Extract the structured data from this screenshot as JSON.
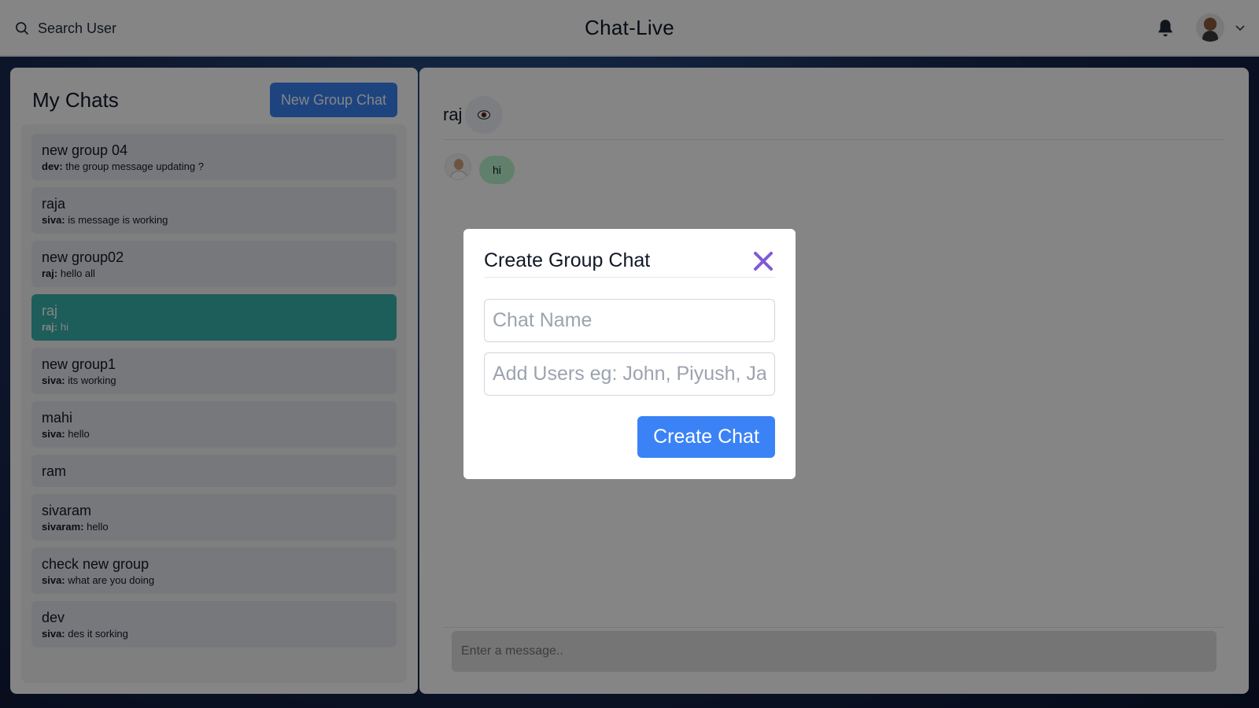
{
  "topbar": {
    "search_label": "Search User",
    "app_title": "Chat-Live"
  },
  "sidebar": {
    "title": "My Chats",
    "new_group_label": "New Group Chat",
    "chats": [
      {
        "name": "new group 04",
        "sender": "dev:",
        "message": " the group message updating ?",
        "active": false
      },
      {
        "name": "raja",
        "sender": "siva:",
        "message": " is message is working",
        "active": false
      },
      {
        "name": "new group02",
        "sender": "raj:",
        "message": " hello all",
        "active": false
      },
      {
        "name": "raj",
        "sender": "raj:",
        "message": " hi",
        "active": true
      },
      {
        "name": "new group1",
        "sender": "siva:",
        "message": " its working",
        "active": false
      },
      {
        "name": "mahi",
        "sender": "siva:",
        "message": " hello",
        "active": false
      },
      {
        "name": "ram",
        "sender": "",
        "message": "",
        "active": false
      },
      {
        "name": "sivaram",
        "sender": "sivaram:",
        "message": " hello",
        "active": false
      },
      {
        "name": "check new group",
        "sender": "siva:",
        "message": " what are you doing",
        "active": false
      },
      {
        "name": "dev",
        "sender": "siva:",
        "message": " des it sorking",
        "active": false
      }
    ]
  },
  "chat_window": {
    "title": "raj",
    "messages": [
      {
        "text": "hi"
      }
    ],
    "input_placeholder": "Enter a message.."
  },
  "modal": {
    "title": "Create Group Chat",
    "chat_name_placeholder": "Chat Name",
    "add_users_placeholder": "Add Users eg: John, Piyush, Jane",
    "create_label": "Create Chat"
  },
  "colors": {
    "accent": "#3b82f6",
    "active_chat": "#38b2ac",
    "bubble": "#b9f5d0",
    "close_icon": "#805ad5"
  }
}
